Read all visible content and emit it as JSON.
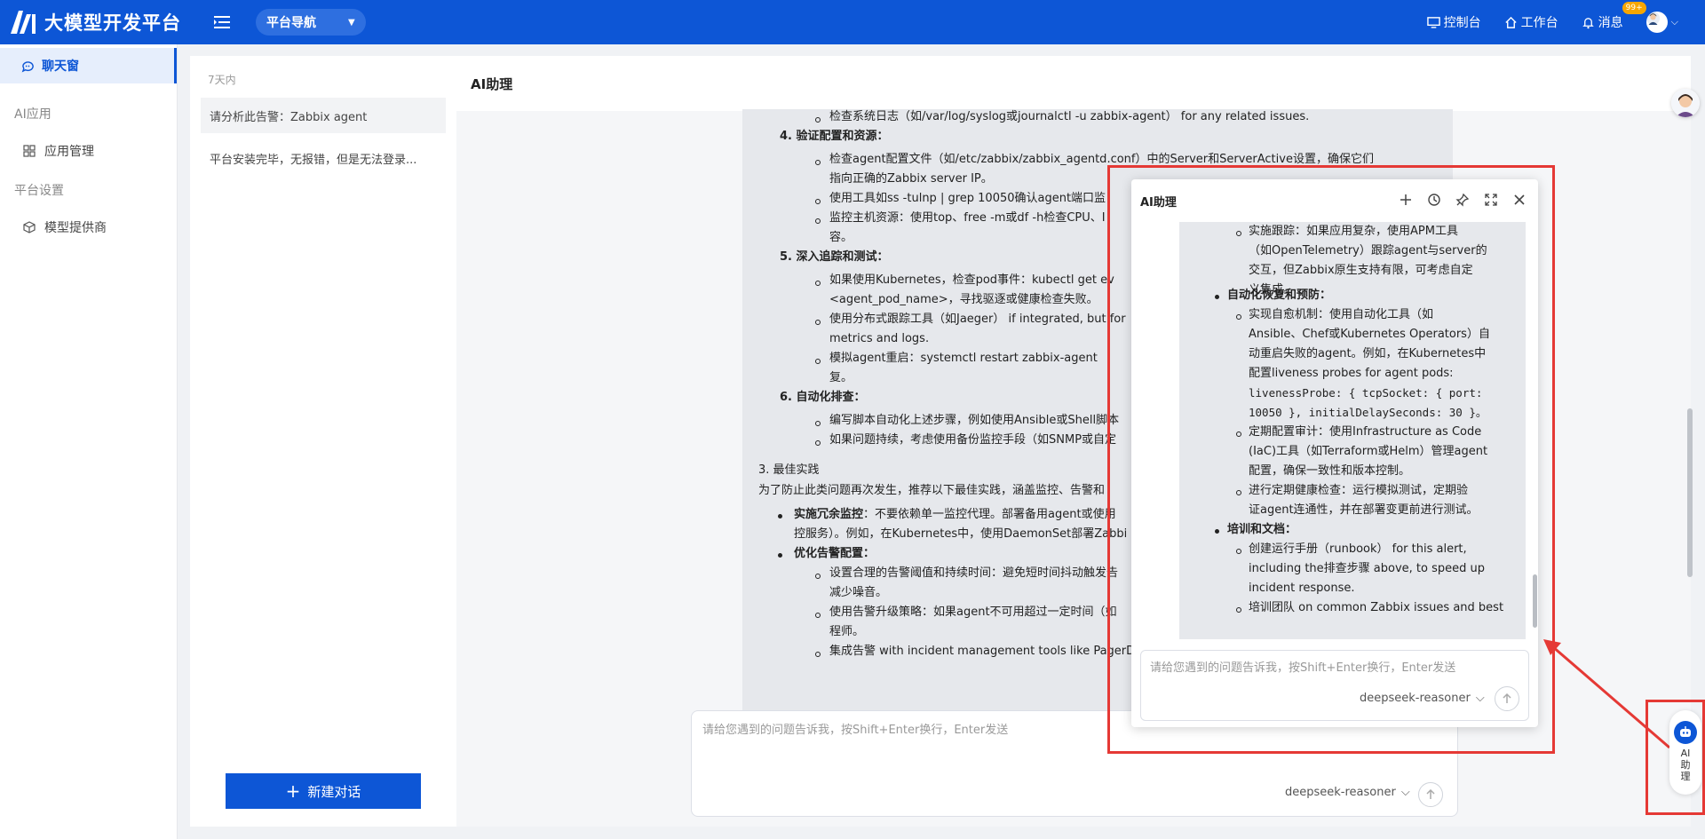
{
  "app": {
    "title": "大模型开发平台",
    "nav_label": "平台导航"
  },
  "top_nav": {
    "console": "控制台",
    "workbench": "工作台",
    "messages": "消息",
    "badge": "99+"
  },
  "sidebar": {
    "chat": "聊天窗",
    "group_ai_apps": "AI应用",
    "app_management": "应用管理",
    "group_settings": "平台设置",
    "model_providers": "模型提供商"
  },
  "conversations": {
    "group": "7天内",
    "items": [
      "请分析此告警：Zabbix agent",
      "平台安装完毕，无报错，但是无法登录..."
    ],
    "new_chat": "新建对话"
  },
  "main": {
    "title": "AI助理",
    "input_placeholder": "请给您遇到的问题告诉我，按Shift+Enter换行，Enter发送",
    "model": "deepseek-reasoner",
    "content": {
      "l1": "检查系统日志（如/var/log/syslog或journalctl -u zabbix-agent） for any related issues.",
      "h4": "4. 验证配置和资源：",
      "l4a_1": "检查agent配置文件（如/etc/zabbix/zabbix_agentd.conf）中的Server和ServerActive设置，确保它们",
      "l4a_2": "指向正确的Zabbix server IP。",
      "l4b": "使用工具如ss -tulnp | grep 10050确认agent端口监",
      "l4c_1": "监控主机资源：使用top、free -m或df -h检查CPU、I",
      "l4c_2": "容。",
      "h5": "5. 深入追踪和测试：",
      "l5a_1": "如果使用Kubernetes，检查pod事件：kubectl get ev",
      "l5a_2": "<agent_pod_name>，寻找驱逐或健康检查失败。",
      "l5b_1": "使用分布式跟踪工具（如Jaeger） if integrated, but for",
      "l5b_2": "metrics and logs.",
      "l5c_1": "模拟agent重启：systemctl restart zabbix-agent",
      "l5c_2": "复。",
      "h6": "6. 自动化排查：",
      "l6a": "编写脚本自动化上述步骤，例如使用Ansible或Shell脚本",
      "l6b": "如果问题持续，考虑使用备份监控手段（如SNMP或自定",
      "h3": "3. 最佳实践",
      "p3": "为了防止此类问题再次发生，推荐以下最佳实践，涵盖监控、告警和",
      "b1_title": "实施冗余监控",
      "b1_text": "：不要依赖单一监控代理。部署备用agent或使用",
      "b1_text2": "控服务）。例如，在Kubernetes中，使用DaemonSet部署Zabbi",
      "b2_title": "优化告警配置",
      "b2a_1": "设置合理的告警阈值和持续时间：避免短时间抖动触发告",
      "b2a_2": "减少噪音。",
      "b2b_1": "使用告警升级策略：如果agent不可用超过一定时间（如",
      "b2b_2": "程师。",
      "b2c": "集成告警 with incident management tools like PagerDu"
    }
  },
  "popup": {
    "title": "AI助理",
    "input_placeholder": "请给您遇到的问题告诉我，按Shift+Enter换行，Enter发送",
    "model": "deepseek-reasoner",
    "content": {
      "c1_1": "实施跟踪：如果应用复杂，使用APM工具",
      "c1_2": "（如OpenTelemetry）跟踪agent与server的",
      "c1_3": "交互，但Zabbix原生支持有限，可考虑自定",
      "c1_4": "义集成。",
      "h_auto": "自动化恢复和预防：",
      "a1_1": "实现自愈机制：使用自动化工具（如",
      "a1_2": "Ansible、Chef或Kubernetes Operators）自",
      "a1_3": "动重启失败的agent。例如，在Kubernetes中",
      "a1_4": "配置liveness probes for agent pods:",
      "a1_5": "livenessProbe: { tcpSocket: { port:",
      "a1_6": "10050 }, initialDelaySeconds: 30 }。",
      "a2_1": "定期配置审计：使用Infrastructure as Code",
      "a2_2": "(IaC)工具（如Terraform或Helm）管理agent",
      "a2_3": "配置，确保一致性和版本控制。",
      "a3_1": "进行定期健康检查：运行模拟测试，定期验",
      "a3_2": "证agent连通性，并在部署变更前进行测试。",
      "h_train": "培训和文档：",
      "t1_1": "创建运行手册（runbook） for this alert,",
      "t1_2": "including the排查步骤 above, to speed up",
      "t1_3": "incident response.",
      "t2": "培训团队 on common Zabbix issues and best"
    }
  },
  "float_button": {
    "label": "AI助理"
  }
}
